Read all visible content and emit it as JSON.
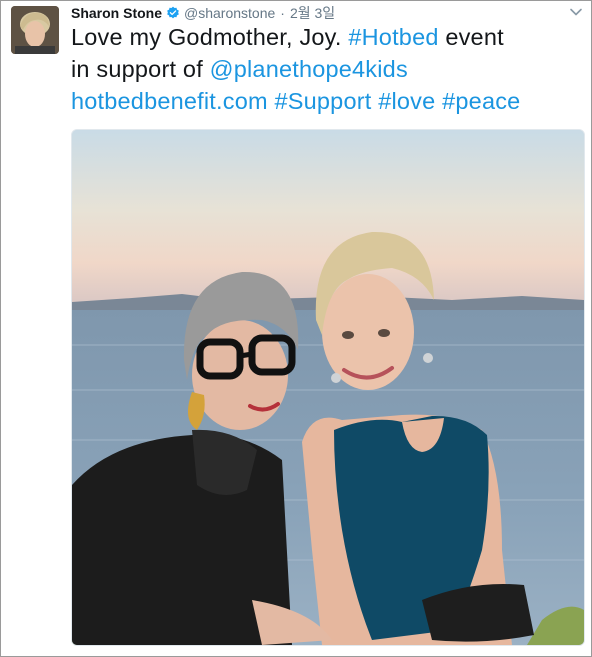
{
  "tweet": {
    "author_name": "Sharon Stone",
    "author_handle": "@sharonstone",
    "separator": "·",
    "timestamp": "2월 3일",
    "verified_icon": "verified-badge-icon",
    "caret_icon": "chevron-down-icon",
    "text": {
      "t1": "Love my Godmother, Joy. ",
      "hashtag_hotbed": "#Hotbed",
      "t2": " event",
      "t3": "in support of ",
      "mention": "@planethope4kids",
      "link": "hotbedbenefit.com",
      "space1": " ",
      "hashtag_support": "#Support",
      "space2": " ",
      "hashtag_love": "#love",
      "space3": " ",
      "hashtag_peace": "#peace"
    },
    "media": {
      "kind": "photo",
      "alt": "two women posing in front of a bay at sunset"
    }
  },
  "colors": {
    "link": "#1b95e0",
    "text": "#14171a",
    "meta": "#657786",
    "border": "#9a9a9a"
  }
}
